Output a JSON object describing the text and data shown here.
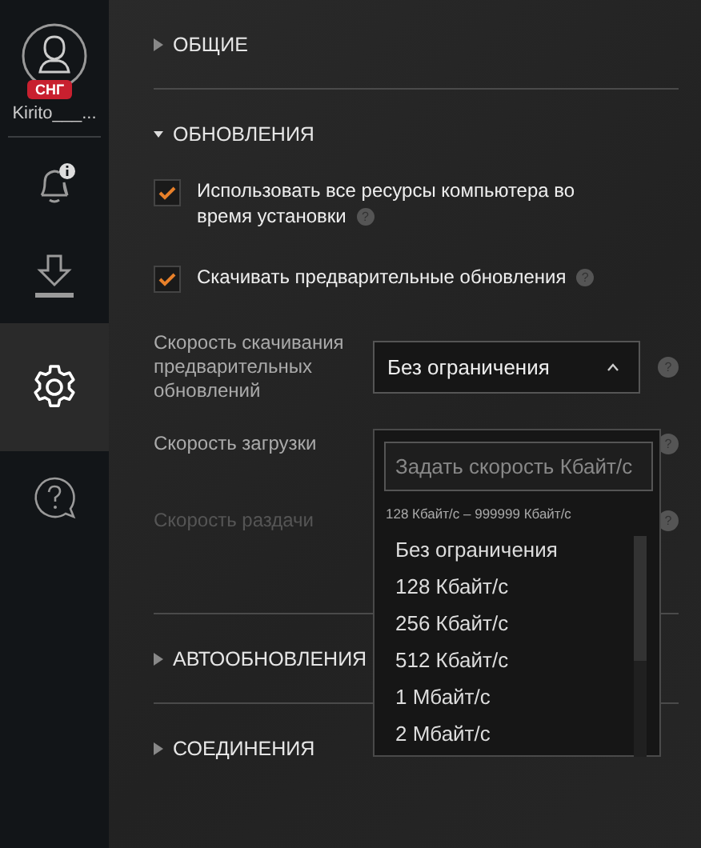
{
  "sidebar": {
    "avatar": {
      "badge": "СНГ",
      "username": "Kirito___..."
    },
    "items": [
      {
        "kind": "bell",
        "selected": false,
        "alert": true
      },
      {
        "kind": "download",
        "selected": false
      },
      {
        "kind": "settings",
        "selected": true
      },
      {
        "kind": "help",
        "selected": false
      }
    ]
  },
  "sections": [
    {
      "title": "ОБЩИЕ",
      "expanded": false
    },
    {
      "title": "ОБНОВЛЕНИЯ",
      "expanded": true,
      "settings": [
        {
          "kind": "checkbox",
          "label": "Использовать все ресурсы компьютера во время установки",
          "checked": true,
          "help": "?"
        },
        {
          "kind": "checkbox",
          "label": "Скачивать предварительные обновления",
          "checked": true,
          "help": "?"
        },
        {
          "kind": "select",
          "label": "Скорость скачивания предварительных обновлений",
          "value": "Без ограничения",
          "disabled": false,
          "open": true,
          "help": "?"
        },
        {
          "kind": "text",
          "label": "Скорость загрузки",
          "disabled": false,
          "help": "?"
        },
        {
          "kind": "text",
          "label": "Скорость раздачи",
          "disabled": true,
          "help": "?"
        }
      ]
    },
    {
      "title": "АВТООБНОВЛЕНИЯ",
      "expanded": false
    },
    {
      "title": "СОЕДИНЕНИЯ",
      "expanded": false
    }
  ],
  "popup": {
    "placeholder": "Задать скорость Кбайт/с",
    "hint": "128 Кбайт/с – 999999 Кбайт/с",
    "options": [
      "Без ограничения",
      "128 Кбайт/с",
      "256 Кбайт/с",
      "512 Кбайт/с",
      "1 Мбайт/с",
      "2 Мбайт/с"
    ]
  }
}
